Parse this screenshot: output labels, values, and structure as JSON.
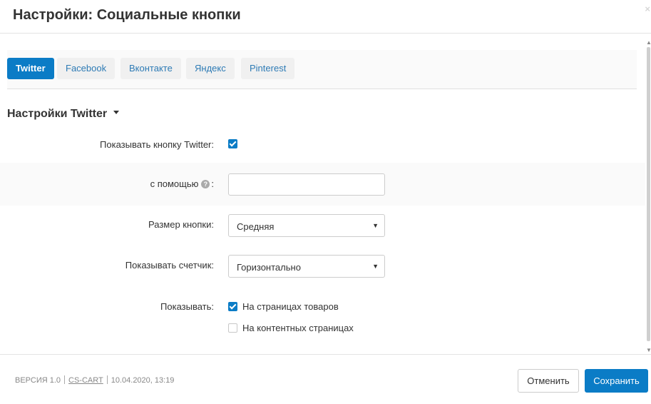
{
  "window": {
    "title": "Настройки: Социальные кнопки",
    "close_glyph": "×"
  },
  "tabs": [
    {
      "label": "Twitter",
      "active": true
    },
    {
      "label": "Facebook",
      "active": false
    },
    {
      "label": "Вконтакте",
      "active": false
    },
    {
      "label": "Яндекс",
      "active": false
    },
    {
      "label": "Pinterest",
      "active": false
    }
  ],
  "section": {
    "title": "Настройки Twitter"
  },
  "form": {
    "show_button": {
      "label": "Показывать кнопку Twitter:",
      "checked": true
    },
    "via": {
      "label_prefix": "с помощью",
      "label_suffix": ":",
      "help_glyph": "?",
      "value": ""
    },
    "button_size": {
      "label": "Размер кнопки:",
      "value": "Средняя"
    },
    "show_counter": {
      "label": "Показывать счетчик:",
      "value": "Горизонтально"
    },
    "display": {
      "label": "Показывать:",
      "options": [
        {
          "label": "На страницах товаров",
          "checked": true
        },
        {
          "label": "На контентных страницах",
          "checked": false
        }
      ]
    }
  },
  "footer": {
    "version": "ВЕРСИЯ 1.0",
    "vendor": "CS-CART",
    "date": "10.04.2020, 13:19",
    "cancel_label": "Отменить",
    "save_label": "Сохранить"
  },
  "icons": {
    "dropdown_arrow": "▼",
    "scroll_up": "▲",
    "scroll_down": "▼"
  },
  "colors": {
    "accent": "#0b7cc6",
    "tab_text": "#2e7bb5",
    "tab_bg": "#f0f0f0"
  }
}
